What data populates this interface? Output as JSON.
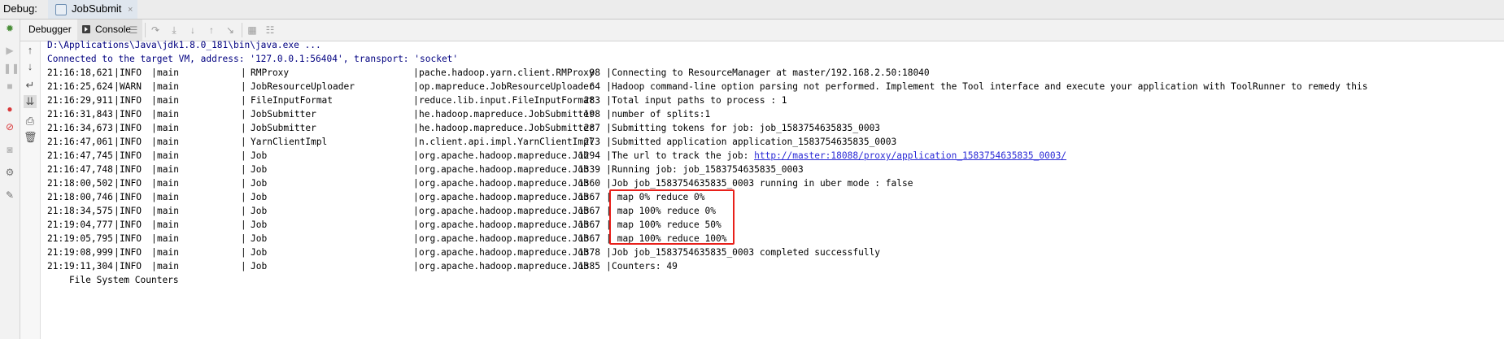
{
  "window": {
    "debug_label": "Debug:",
    "run_tab": "JobSubmit",
    "run_tab_close": "×"
  },
  "subbar": {
    "debugger_tab": "Debugger",
    "console_tab": "Console"
  },
  "console": {
    "command_line": "D:\\Applications\\Java\\jdk1.8.0_181\\bin\\java.exe ...",
    "connected_line": "Connected to the target VM, address: '127.0.0.1:56404', transport: 'socket'",
    "log_rows": [
      {
        "time": "21:16:18,621",
        "level": "INFO",
        "thread": "main",
        "logger": "RMProxy",
        "class": "pache.hadoop.yarn.client.RMProxy",
        "line": "98",
        "message": "Connecting to ResourceManager at master/192.168.2.50:18040"
      },
      {
        "time": "21:16:25,624",
        "level": "WARN",
        "thread": "main",
        "logger": "JobResourceUploader",
        "class": "op.mapreduce.JobResourceUploader",
        "line": "64",
        "message": "Hadoop command-line option parsing not performed. Implement the Tool interface and execute your application with ToolRunner to remedy this"
      },
      {
        "time": "21:16:29,911",
        "level": "INFO",
        "thread": "main",
        "logger": "FileInputFormat",
        "class": "reduce.lib.input.FileInputFormat",
        "line": "283",
        "message": "Total input paths to process : 1"
      },
      {
        "time": "21:16:31,843",
        "level": "INFO",
        "thread": "main",
        "logger": "JobSubmitter",
        "class": "he.hadoop.mapreduce.JobSubmitter",
        "line": "198",
        "message": "number of splits:1"
      },
      {
        "time": "21:16:34,673",
        "level": "INFO",
        "thread": "main",
        "logger": "JobSubmitter",
        "class": "he.hadoop.mapreduce.JobSubmitter",
        "line": "287",
        "message": "Submitting tokens for job: job_1583754635835_0003"
      },
      {
        "time": "21:16:47,061",
        "level": "INFO",
        "thread": "main",
        "logger": "YarnClientImpl",
        "class": "n.client.api.impl.YarnClientImpl",
        "line": "273",
        "message": "Submitted application application_1583754635835_0003"
      },
      {
        "time": "21:16:47,745",
        "level": "INFO",
        "thread": "main",
        "logger": "Job",
        "class": "org.apache.hadoop.mapreduce.Job",
        "line": "1294",
        "message": "The url to track the job: ",
        "link": "http://master:18088/proxy/application_1583754635835_0003/"
      },
      {
        "time": "21:16:47,748",
        "level": "INFO",
        "thread": "main",
        "logger": "Job",
        "class": "org.apache.hadoop.mapreduce.Job",
        "line": "1339",
        "message": "Running job: job_1583754635835_0003"
      },
      {
        "time": "21:18:00,502",
        "level": "INFO",
        "thread": "main",
        "logger": "Job",
        "class": "org.apache.hadoop.mapreduce.Job",
        "line": "1360",
        "message": "Job job_1583754635835_0003 running in uber mode : false"
      },
      {
        "time": "21:18:00,746",
        "level": "INFO",
        "thread": "main",
        "logger": "Job",
        "class": "org.apache.hadoop.mapreduce.Job",
        "line": "1367",
        "message": " map 0% reduce 0%"
      },
      {
        "time": "21:18:34,575",
        "level": "INFO",
        "thread": "main",
        "logger": "Job",
        "class": "org.apache.hadoop.mapreduce.Job",
        "line": "1367",
        "message": " map 100% reduce 0%"
      },
      {
        "time": "21:19:04,777",
        "level": "INFO",
        "thread": "main",
        "logger": "Job",
        "class": "org.apache.hadoop.mapreduce.Job",
        "line": "1367",
        "message": " map 100% reduce 50%"
      },
      {
        "time": "21:19:05,795",
        "level": "INFO",
        "thread": "main",
        "logger": "Job",
        "class": "org.apache.hadoop.mapreduce.Job",
        "line": "1367",
        "message": " map 100% reduce 100%"
      },
      {
        "time": "21:19:08,999",
        "level": "INFO",
        "thread": "main",
        "logger": "Job",
        "class": "org.apache.hadoop.mapreduce.Job",
        "line": "1378",
        "message": "Job job_1583754635835_0003 completed successfully"
      },
      {
        "time": "21:19:11,304",
        "level": "INFO",
        "thread": "main",
        "logger": "Job",
        "class": "org.apache.hadoop.mapreduce.Job",
        "line": "1385",
        "message": "Counters: 49"
      }
    ],
    "trailing_line": "    File System Counters",
    "separator": "|"
  },
  "colors": {
    "highlight_box": "#e8201a",
    "link": "#2a2ad6",
    "command_text": "#000080"
  }
}
